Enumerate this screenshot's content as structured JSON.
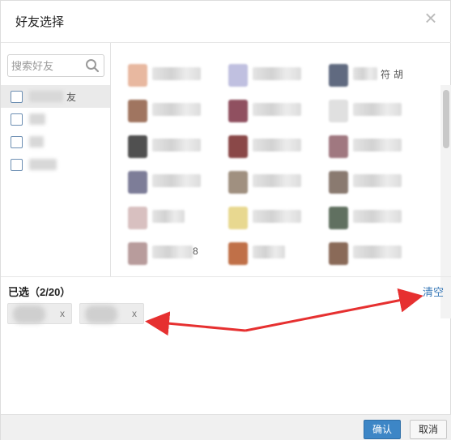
{
  "dialog": {
    "title": "好友选择"
  },
  "search": {
    "placeholder": "搜索好友"
  },
  "groups": [
    {
      "label": "友",
      "active": true
    },
    {
      "label": "",
      "active": false
    },
    {
      "label": "",
      "active": false
    },
    {
      "label": "",
      "active": false
    }
  ],
  "friends_fragments": {
    "f3": "符",
    "f3b": "胡",
    "f14": "8"
  },
  "selected": {
    "label": "已选（2/20）",
    "clear_label": "清空",
    "chip_remove": "x"
  },
  "footer": {
    "confirm_label": "确认",
    "cancel_label": "取消"
  },
  "colors": {
    "primary": "#3d86c6",
    "link": "#3a7ab8",
    "arrow": "#e63030"
  }
}
